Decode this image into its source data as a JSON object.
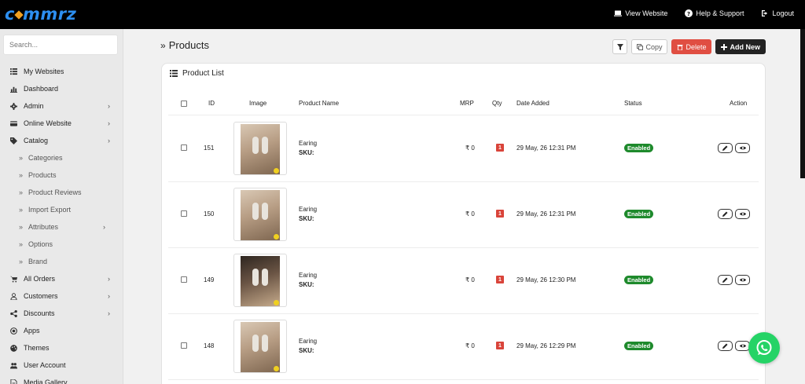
{
  "brand": {
    "logo_text_a": "c",
    "logo_text_b": "mmrz",
    "accent": "#2d8ff0"
  },
  "topnav": {
    "view_website": "View Website",
    "help": "Help & Support",
    "logout": "Logout"
  },
  "sidebar": {
    "search_placeholder": "Search...",
    "items": [
      {
        "label": "My Websites",
        "icon": "list-icon",
        "chevron": false,
        "sub": false
      },
      {
        "label": "Dashboard",
        "icon": "chart-icon",
        "chevron": false,
        "sub": false
      },
      {
        "label": "Admin",
        "icon": "gear-icon",
        "chevron": true,
        "sub": false
      },
      {
        "label": "Online Website",
        "icon": "card-icon",
        "chevron": true,
        "sub": false
      },
      {
        "label": "Catalog",
        "icon": "tags-icon",
        "chevron": true,
        "sub": false
      },
      {
        "label": "Categories",
        "chevron": false,
        "sub": true
      },
      {
        "label": "Products",
        "chevron": false,
        "sub": true
      },
      {
        "label": "Product Reviews",
        "chevron": false,
        "sub": true
      },
      {
        "label": "Import Export",
        "chevron": false,
        "sub": true
      },
      {
        "label": "Attributes",
        "chevron": true,
        "sub": true
      },
      {
        "label": "Options",
        "chevron": false,
        "sub": true
      },
      {
        "label": "Brand",
        "chevron": false,
        "sub": true
      },
      {
        "label": "All Orders",
        "icon": "cart-icon",
        "chevron": true,
        "sub": false
      },
      {
        "label": "Customers",
        "icon": "user-icon",
        "chevron": true,
        "sub": false
      },
      {
        "label": "Discounts",
        "icon": "share-icon",
        "chevron": true,
        "sub": false
      },
      {
        "label": "Apps",
        "icon": "circle-icon",
        "chevron": false,
        "sub": false
      },
      {
        "label": "Themes",
        "icon": "palette-icon",
        "chevron": false,
        "sub": false
      },
      {
        "label": "User Account",
        "icon": "users-icon",
        "chevron": false,
        "sub": false
      },
      {
        "label": "Media Gallery",
        "icon": "file-icon",
        "chevron": false,
        "sub": false
      }
    ]
  },
  "page": {
    "title": "Products",
    "copy_label": "Copy",
    "delete_label": "Delete",
    "add_label": "Add New"
  },
  "panel": {
    "title": "Product List",
    "columns": {
      "id": "ID",
      "image": "Image",
      "name": "Product Name",
      "mrp": "MRP",
      "qty": "Qty",
      "date": "Date Added",
      "status": "Status",
      "action": "Action"
    },
    "rows": [
      {
        "id": "151",
        "name": "Earing",
        "sku": "SKU:",
        "mrp": "₹ 0",
        "qty": "1",
        "date": "29 May, 26 12:31 PM",
        "status": "Enabled"
      },
      {
        "id": "150",
        "name": "Earing",
        "sku": "SKU:",
        "mrp": "₹ 0",
        "qty": "1",
        "date": "29 May, 26 12:31 PM",
        "status": "Enabled"
      },
      {
        "id": "149",
        "name": "Earing",
        "sku": "SKU:",
        "mrp": "₹ 0",
        "qty": "1",
        "date": "29 May, 26 12:30 PM",
        "status": "Enabled"
      },
      {
        "id": "148",
        "name": "Earing",
        "sku": "SKU:",
        "mrp": "₹ 0",
        "qty": "1",
        "date": "29 May, 26 12:29 PM",
        "status": "Enabled"
      }
    ]
  }
}
